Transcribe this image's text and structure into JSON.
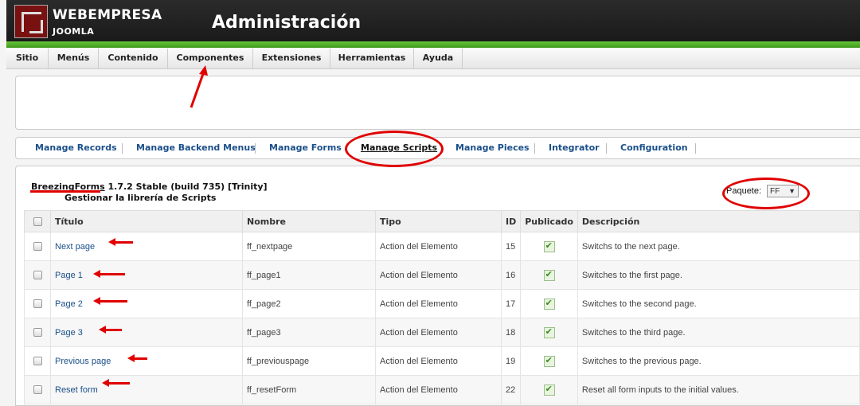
{
  "header": {
    "brand_top": "WEBEMPRESA",
    "brand_bottom": "JOOMLA",
    "title": "Administración"
  },
  "menu": [
    "Sitio",
    "Menús",
    "Contenido",
    "Componentes",
    "Extensiones",
    "Herramientas",
    "Ayuda"
  ],
  "submenu": [
    "Manage Records",
    "Manage Backend Menus",
    "Manage Forms",
    "Manage Scripts",
    "Manage Pieces",
    "Integrator",
    "Configuration"
  ],
  "submenu_active": "Manage Scripts",
  "component": {
    "name": "BreezingForms",
    "version": "1.7.2 Stable (build 735) [Trinity]",
    "subtitle": "Gestionar la librería de Scripts"
  },
  "filter": {
    "label": "Paquete:",
    "value": "FF"
  },
  "table": {
    "columns": [
      "Título",
      "Nombre",
      "Tipo",
      "ID",
      "Publicado",
      "Descripción"
    ],
    "rows": [
      {
        "title": "Next page",
        "name": "ff_nextpage",
        "type": "Action del Elemento",
        "id": "15",
        "desc": "Switchs to the next page."
      },
      {
        "title": "Page 1",
        "name": "ff_page1",
        "type": "Action del Elemento",
        "id": "16",
        "desc": "Switches to the first page."
      },
      {
        "title": "Page 2",
        "name": "ff_page2",
        "type": "Action del Elemento",
        "id": "17",
        "desc": "Switches to the second page."
      },
      {
        "title": "Page 3",
        "name": "ff_page3",
        "type": "Action del Elemento",
        "id": "18",
        "desc": "Switches to the third page."
      },
      {
        "title": "Previous page",
        "name": "ff_previouspage",
        "type": "Action del Elemento",
        "id": "19",
        "desc": "Switches to the previous page."
      },
      {
        "title": "Reset form",
        "name": "ff_resetForm",
        "type": "Action del Elemento",
        "id": "22",
        "desc": "Reset all form inputs to the initial values."
      }
    ]
  },
  "colors": {
    "header_bg": "#222222",
    "accent_green": "#4fb025",
    "link_blue": "#1a4f8a",
    "annotation_red": "#e00000"
  }
}
